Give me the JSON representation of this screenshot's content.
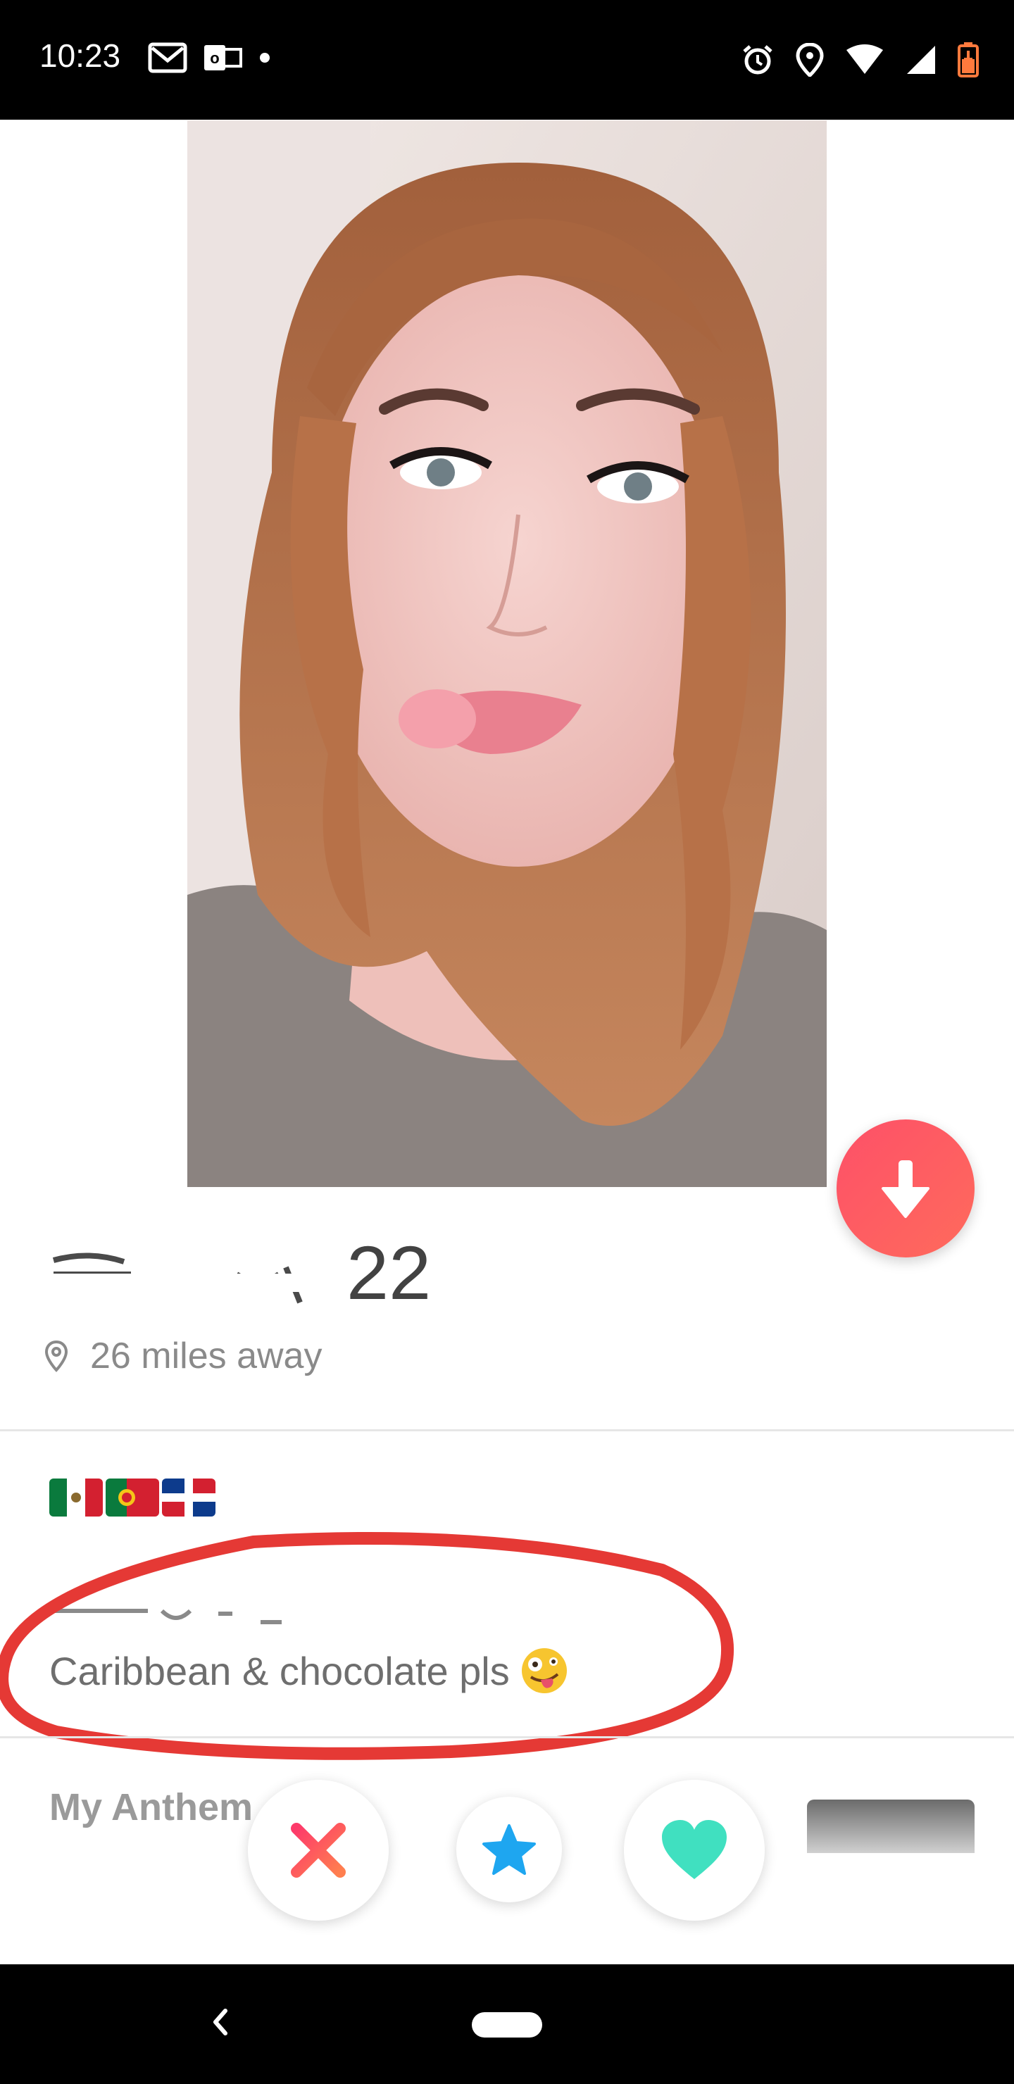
{
  "status_bar": {
    "time": "10:23",
    "left_icons": [
      "gmail-icon",
      "outlook-icon",
      "dot-icon"
    ],
    "right_icons": [
      "alarm-icon",
      "location-icon",
      "wifi-icon",
      "cell-signal-icon",
      "battery-charging-icon"
    ]
  },
  "profile": {
    "photo_description": "profile-photo",
    "age": "22",
    "distance": "26 miles away"
  },
  "bio": {
    "flags": [
      "flag-mexico",
      "flag-portugal",
      "flag-dominican-republic"
    ],
    "line": "Caribbean & chocolate pls",
    "emoji": "🤪"
  },
  "anthem": {
    "title": "My Anthem"
  },
  "actions": {
    "nope": "nope-button",
    "superlike": "super-like-button",
    "like": "like-button"
  },
  "colors": {
    "tinder_gradient_start": "#fd5068",
    "tinder_gradient_end": "#ff6b5c",
    "nope_red": "#fd5068",
    "superlike_blue": "#1ea6f0",
    "like_green": "#40e0c0",
    "annotation_red": "#e53935"
  }
}
